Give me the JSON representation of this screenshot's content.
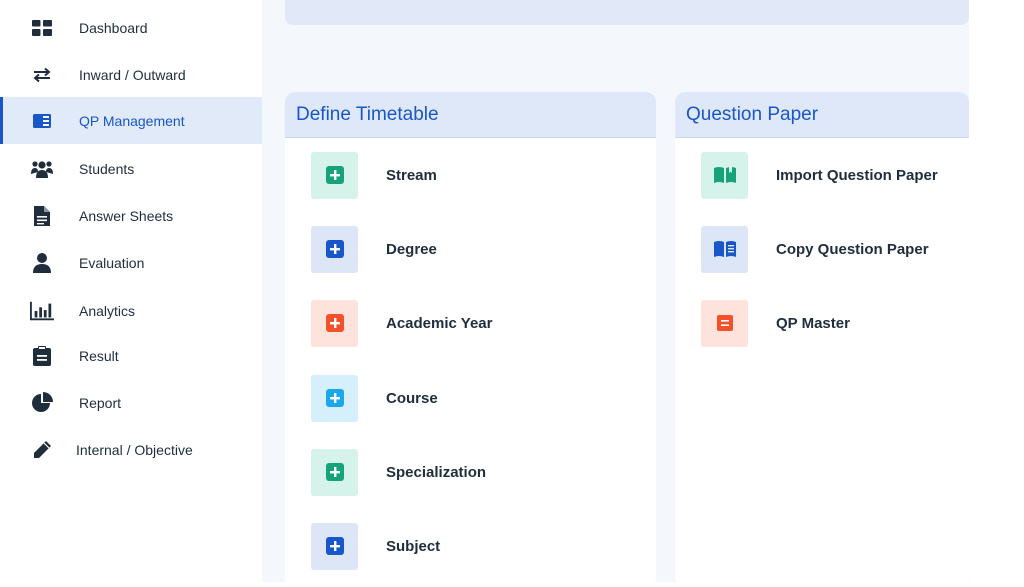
{
  "sidebar": {
    "items": [
      {
        "label": "Dashboard",
        "icon": "dashboard-icon"
      },
      {
        "label": "Inward / Outward",
        "icon": "swap-arrows-icon"
      },
      {
        "label": "QP Management",
        "icon": "book-icon",
        "active": true
      },
      {
        "label": "Students",
        "icon": "users-icon"
      },
      {
        "label": "Answer Sheets",
        "icon": "document-icon"
      },
      {
        "label": "Evaluation",
        "icon": "user-icon"
      },
      {
        "label": "Analytics",
        "icon": "bar-chart-icon"
      },
      {
        "label": "Result",
        "icon": "clipboard-icon"
      },
      {
        "label": "Report",
        "icon": "pie-chart-icon"
      },
      {
        "label": "Internal / Objective",
        "icon": "pencil-icon"
      }
    ]
  },
  "define_timetable": {
    "title": "Define Timetable",
    "items": [
      {
        "label": "Stream",
        "icon": "plus-square-icon",
        "color": "#17a37a",
        "bg": "#d5f3ea"
      },
      {
        "label": "Degree",
        "icon": "plus-square-icon",
        "color": "#1856c9",
        "bg": "#dce6f7"
      },
      {
        "label": "Academic Year",
        "icon": "plus-square-icon",
        "color": "#f4512b",
        "bg": "#fde3dc"
      },
      {
        "label": "Course",
        "icon": "plus-square-icon",
        "color": "#1aa8ea",
        "bg": "#d5f0fc"
      },
      {
        "label": "Specialization",
        "icon": "plus-square-icon",
        "color": "#17a37a",
        "bg": "#d5f3ea"
      },
      {
        "label": "Subject",
        "icon": "plus-square-icon",
        "color": "#1856c9",
        "bg": "#dce6f7"
      }
    ]
  },
  "question_paper": {
    "title": "Question Paper",
    "items": [
      {
        "label": "Import Question Paper",
        "icon": "open-book-icon",
        "color": "#17a37a",
        "bg": "#d5f3ea"
      },
      {
        "label": "Copy Question Paper",
        "icon": "book-open-reader-icon",
        "color": "#1856c9",
        "bg": "#dce6f7"
      },
      {
        "label": "QP Master",
        "icon": "list-square-icon",
        "color": "#f4512b",
        "bg": "#fde3dc"
      }
    ]
  },
  "colors": {
    "accent": "#1856c9",
    "sidebar_active_bg": "#e0eaf9",
    "main_bg": "#f4f7fc",
    "card_header_bg": "#dfe8f8"
  }
}
